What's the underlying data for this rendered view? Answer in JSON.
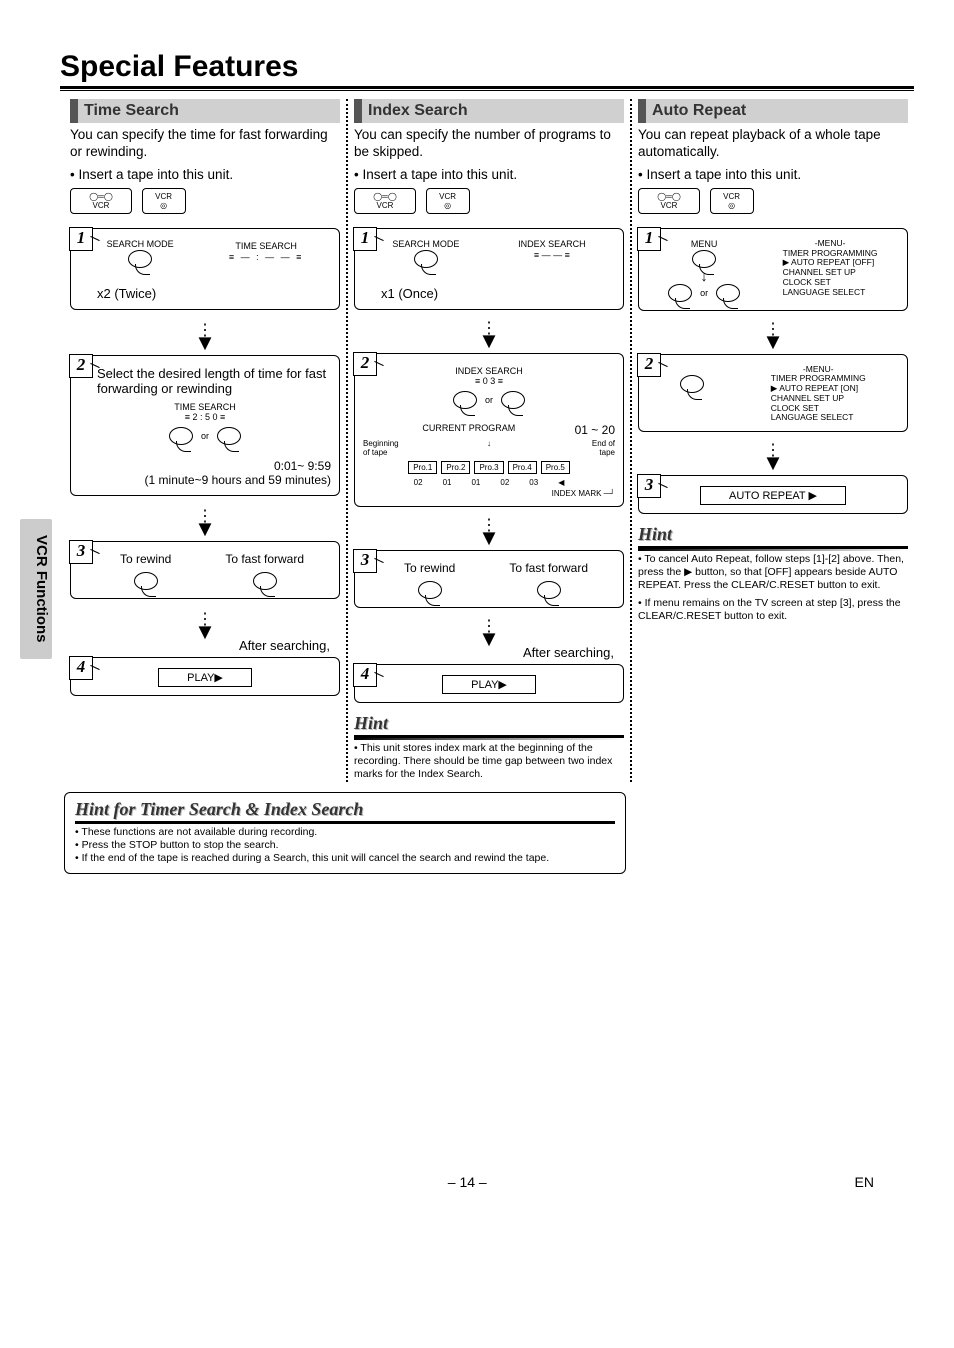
{
  "page": {
    "title": "Special Features",
    "sideTab": "VCR Functions",
    "pageNumber": "– 14 –",
    "lang": "EN"
  },
  "iconLabels": {
    "vcrTape": "VCR",
    "vcrChip": "VCR"
  },
  "timeSearch": {
    "header": "Time Search",
    "intro": "You can specify the time for fast forwarding or rewinding.",
    "insert": "• Insert a tape into this unit.",
    "step1": {
      "displayTitle": "TIME SEARCH",
      "displayValue": "— : — —",
      "modeLabel": "SEARCH MODE",
      "caption": "x2 (Twice)"
    },
    "step2": {
      "text": "Select the desired length of time for fast forwarding or rewinding",
      "displayTitle": "TIME SEARCH",
      "displayValue": "2 : 5 0",
      "or": "or",
      "range": "0:01~ 9:59",
      "rangeNote": "(1 minute~9 hours and 59 minutes)"
    },
    "step3": {
      "left": "To rewind",
      "right": "To fast forward",
      "after": "After searching,"
    },
    "step4": {
      "play": "PLAY▶"
    }
  },
  "indexSearch": {
    "header": "Index Search",
    "intro": "You can specify the number of programs to be skipped.",
    "insert": "• Insert a tape into this unit.",
    "step1": {
      "displayTitle": "INDEX SEARCH",
      "displayValue": "— —",
      "modeLabel": "SEARCH MODE",
      "caption": "x1 (Once)"
    },
    "step2": {
      "displayTitle": "INDEX SEARCH",
      "displayValue": "0 3",
      "or": "or",
      "currentProgram": "CURRENT PROGRAM",
      "range": "01 ~ 20",
      "begin": "Beginning of tape",
      "end": "End of tape",
      "pro": [
        "Pro.1",
        "Pro.2",
        "Pro.3",
        "Pro.4",
        "Pro.5"
      ],
      "nums": [
        "02",
        "01",
        "01",
        "02",
        "03"
      ],
      "indexMark": "INDEX MARK"
    },
    "step3": {
      "left": "To rewind",
      "right": "To fast forward",
      "after": "After searching,"
    },
    "step4": {
      "play": "PLAY▶"
    },
    "hint": {
      "title": "Hint",
      "body": "• This unit stores index mark at the beginning of the recording. There should be time gap between two index marks for the Index Search."
    }
  },
  "autoRepeat": {
    "header": "Auto Repeat",
    "intro": "You can repeat playback of a whole tape automatically.",
    "insert": "• Insert a tape into this unit.",
    "step1": {
      "menuBtn": "MENU",
      "menuTitle": "-MENU-",
      "menuLines": [
        "TIMER PROGRAMMING",
        "▶ AUTO REPEAT  [OFF]",
        "CHANNEL SET UP",
        "CLOCK SET",
        "LANGUAGE SELECT"
      ],
      "or": "or"
    },
    "step2": {
      "menuTitle": "-MENU-",
      "menuLines": [
        "TIMER PROGRAMMING",
        "▶ AUTO REPEAT  [ON]",
        "CHANNEL SET UP",
        "CLOCK SET",
        "LANGUAGE SELECT"
      ]
    },
    "step3": {
      "display": "AUTO REPEAT ▶"
    },
    "hint": {
      "title": "Hint",
      "body1": "• To cancel Auto Repeat, follow steps [1]-[2] above. Then, press the ▶ button, so that [OFF] appears beside AUTO REPEAT. Press the CLEAR/C.RESET button to exit.",
      "body2": "• If menu remains on the TV screen at step [3], press the CLEAR/C.RESET button to exit."
    }
  },
  "bottomHint": {
    "title": "Hint for Timer Search & Index Search",
    "lines": [
      "• These functions are not available during recording.",
      "• Press the STOP button to stop the search.",
      "• If the end of the tape is reached during a Search, this unit will cancel the search and rewind the tape."
    ]
  }
}
